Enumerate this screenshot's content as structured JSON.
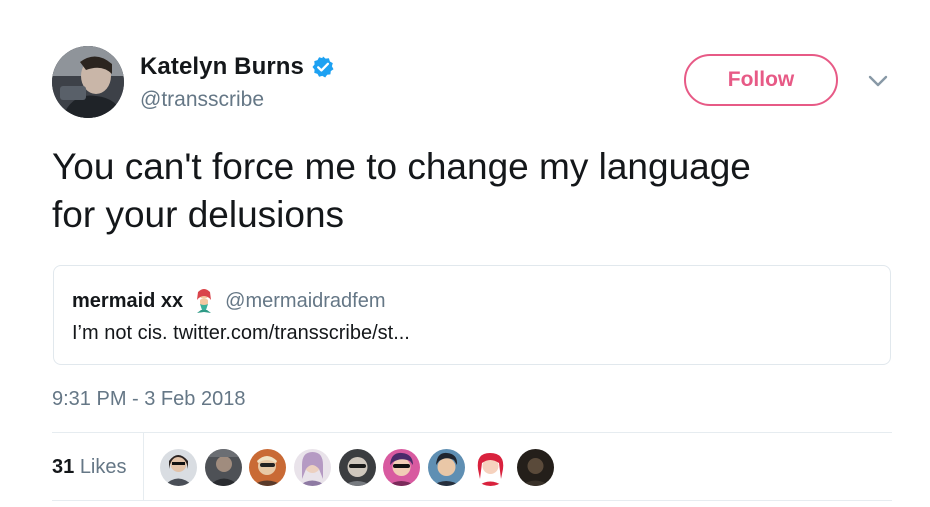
{
  "author": {
    "display_name": "Katelyn Burns",
    "username": "@transscribe",
    "verified": true,
    "avatar_icon": "profile-photo"
  },
  "actions": {
    "follow_label": "Follow",
    "menu_icon": "chevron-down-icon"
  },
  "tweet": {
    "text_line1": "You can't force me to change my language",
    "text_line2": "for your delusions",
    "timestamp": "9:31 PM - 3 Feb 2018"
  },
  "quoted_tweet": {
    "display_name": "mermaid xx",
    "emoji": "mermaid-icon",
    "username": "@mermaidradfem",
    "text": "I’m not cis. twitter.com/transscribe/st..."
  },
  "stats": {
    "likes_count": "31",
    "likes_label": "Likes"
  },
  "colors": {
    "follow_accent": "#e0245e",
    "verified_blue": "#1da1f2",
    "secondary_text": "#657786",
    "primary_text": "#14171a",
    "border": "#e1e8ed"
  }
}
